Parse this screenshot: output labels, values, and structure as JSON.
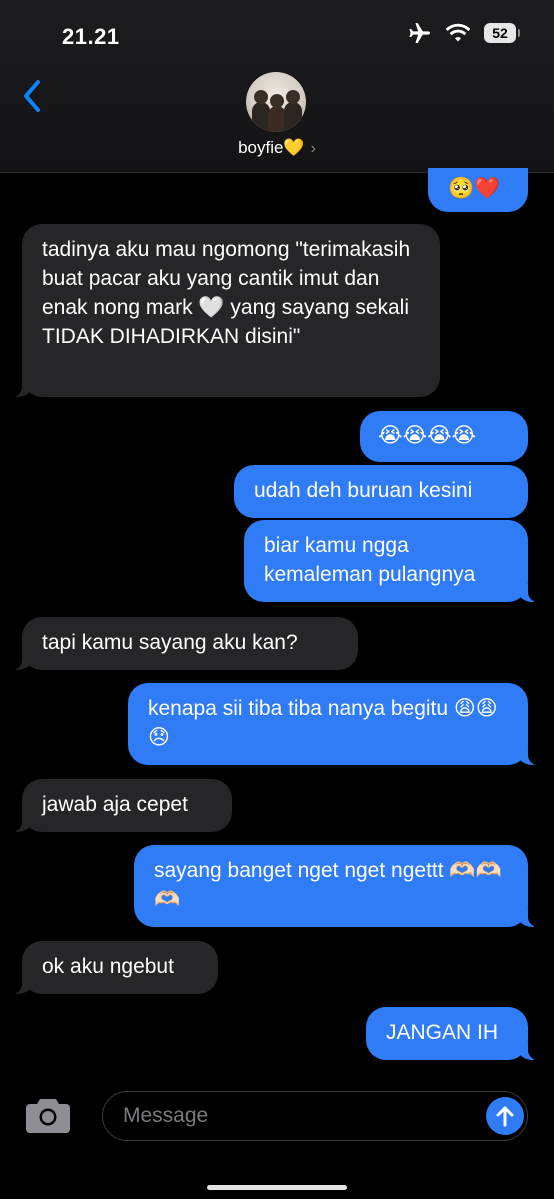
{
  "status": {
    "time": "21.21",
    "battery": "52"
  },
  "header": {
    "contact_name": "boyfie💛",
    "chevron": "›"
  },
  "messages": [
    {
      "from": "me",
      "text": "🥺❤️"
    },
    {
      "from": "them",
      "text": "tadinya aku mau ngomong \"terimakasih buat pacar aku yang cantik imut dan enak nong mark 🤍 yang sayang sekali TIDAK DIHADIRKAN disini\""
    },
    {
      "from": "me",
      "text": "😭😭😭😭"
    },
    {
      "from": "me",
      "text": "udah deh buruan kesini"
    },
    {
      "from": "me",
      "text": "biar kamu ngga kemaleman pulangnya"
    },
    {
      "from": "them",
      "text": "tapi kamu sayang aku kan?"
    },
    {
      "from": "me",
      "text": "kenapa sii tiba tiba nanya begitu 😩😩😞"
    },
    {
      "from": "them",
      "text": "jawab aja cepet"
    },
    {
      "from": "me",
      "text": "sayang banget nget nget ngettt 🫶🏻🫶🏻🫶🏻"
    },
    {
      "from": "them",
      "text": "ok aku ngebut"
    },
    {
      "from": "me",
      "text": "JANGAN IH"
    }
  ],
  "composer": {
    "placeholder": "Message"
  },
  "colors": {
    "outgoing": "#2f7cf6",
    "incoming": "#262628",
    "accent": "#0a84ff"
  },
  "icons": [
    "back-chevron-icon",
    "camera-icon",
    "send-arrow-icon",
    "airplane-icon",
    "wifi-icon",
    "battery-icon"
  ]
}
